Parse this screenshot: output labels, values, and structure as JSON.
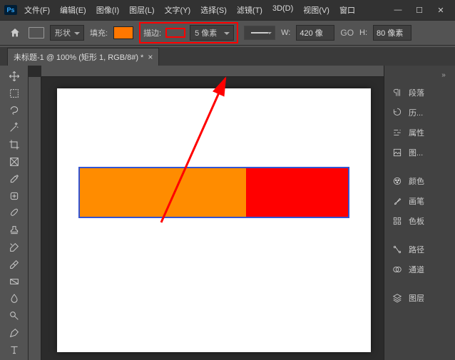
{
  "menus": {
    "file": "文件(F)",
    "edit": "编辑(E)",
    "image": "图像(I)",
    "layer": "图层(L)",
    "type": "文字(Y)",
    "select": "选择(S)",
    "filter": "滤镜(T)",
    "threeD": "3D(D)",
    "view": "视图(V)",
    "window": "窗口"
  },
  "opt": {
    "mode": "形状",
    "fill_label": "填充:",
    "stroke_label": "描边:",
    "stroke_width": "5 像素",
    "W_label": "W:",
    "W_value": "420 像",
    "H_label": "H:",
    "H_value": "80 像素",
    "link": "GO"
  },
  "tab": {
    "title": "未标题-1 @ 100% (矩形 1, RGB/8#) *"
  },
  "panels": {
    "paragraph": "段落",
    "history": "历...",
    "properties": "属性",
    "libraries": "图...",
    "color": "颜色",
    "brushes": "画笔",
    "swatches": "色板",
    "paths": "路径",
    "channels": "通道",
    "layers": "图层"
  }
}
